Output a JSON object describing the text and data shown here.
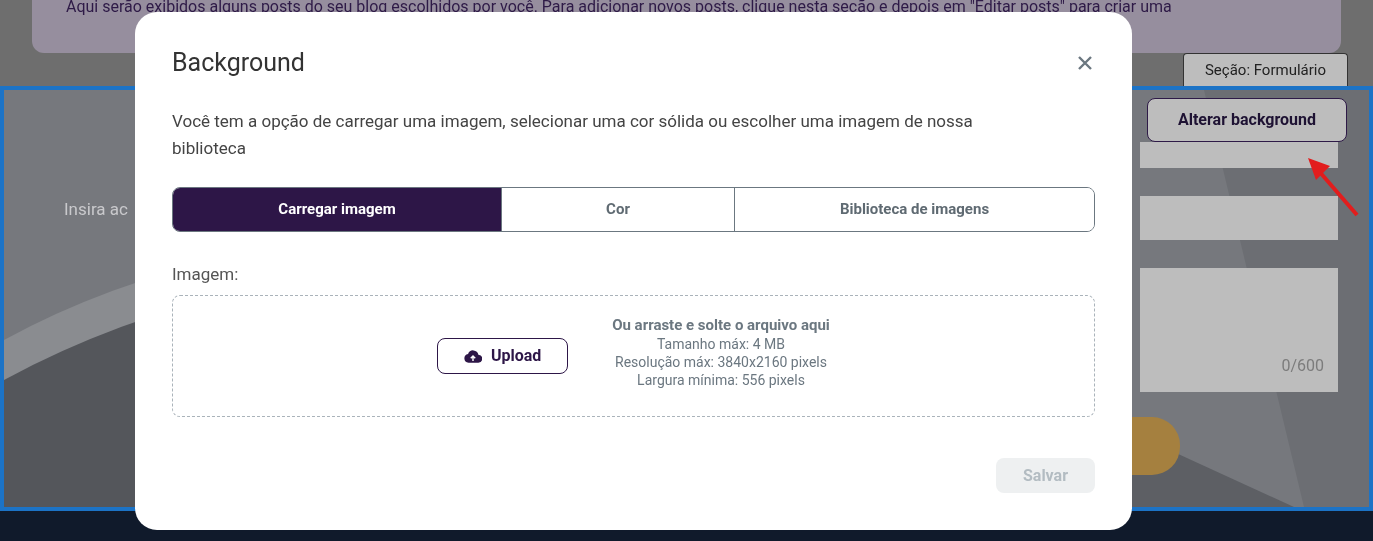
{
  "page": {
    "info_text": "Aqui serão exibidos alguns posts do seu blog escolhidos por você. Para adicionar novos posts, clique nesta seção e depois em \"Editar posts\" para criar uma",
    "section_tab": "Seção: Formulário",
    "hint_text": "Insira ac",
    "counter": "0/600",
    "change_background_button": "Alterar background"
  },
  "modal": {
    "title": "Background",
    "description": "Você tem a opção de carregar uma imagem, selecionar uma cor sólida ou escolher uma imagem de nossa biblioteca",
    "tabs": [
      {
        "label": "Carregar imagem",
        "selected": true
      },
      {
        "label": "Cor",
        "selected": false
      },
      {
        "label": "Biblioteca de imagens",
        "selected": false
      }
    ],
    "image_label": "Imagem:",
    "upload_button": "Upload",
    "drop_title": "Ou arraste e solte o arquivo aqui",
    "requirements": [
      "Tamanho máx: 4 MB",
      "Resolução máx: 3840x2160 pixels",
      "Largura mínima: 556 pixels"
    ],
    "save_button": {
      "label": "Salvar",
      "disabled": true
    }
  }
}
